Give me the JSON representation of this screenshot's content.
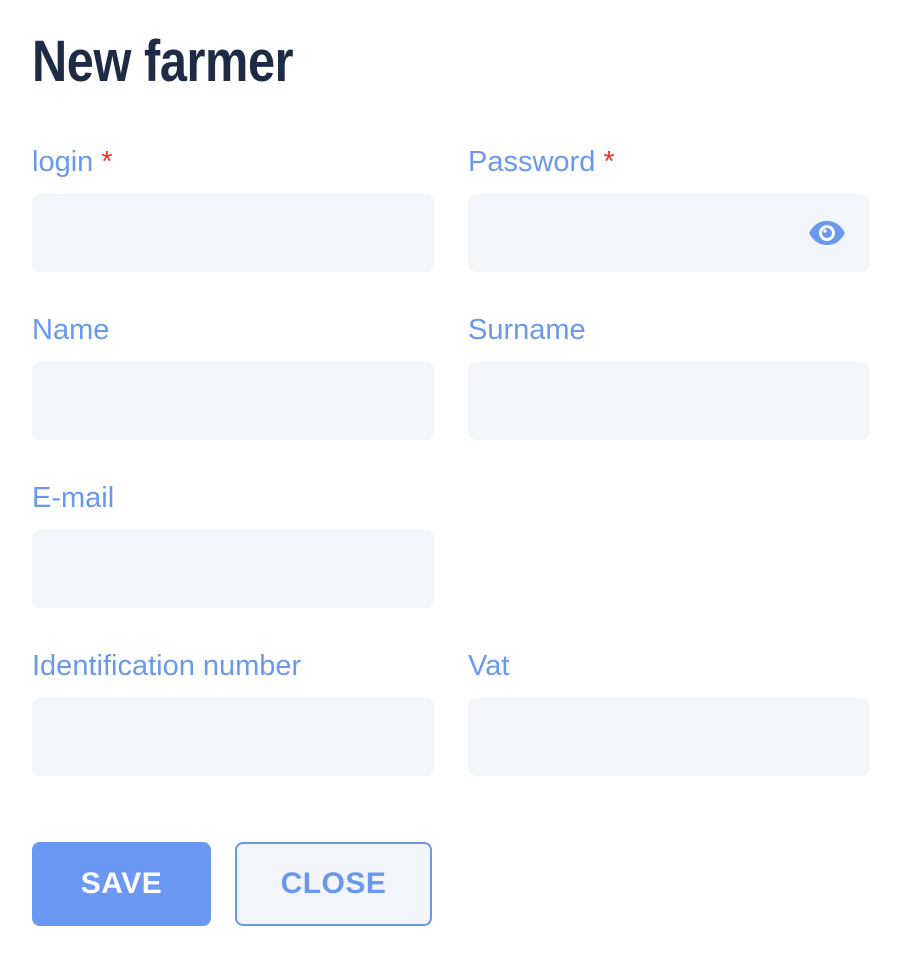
{
  "form": {
    "title": "New farmer",
    "fields": {
      "login": {
        "label": "login",
        "required_mark": "*",
        "value": ""
      },
      "password": {
        "label": "Password",
        "required_mark": "*",
        "value": ""
      },
      "name": {
        "label": "Name",
        "value": ""
      },
      "surname": {
        "label": "Surname",
        "value": ""
      },
      "email": {
        "label": "E-mail",
        "value": ""
      },
      "identification_number": {
        "label": "Identification number",
        "value": ""
      },
      "vat": {
        "label": "Vat",
        "value": ""
      }
    },
    "actions": {
      "save_label": "SAVE",
      "close_label": "CLOSE"
    }
  },
  "icons": {
    "password_toggle": "eye-icon"
  },
  "colors": {
    "title": "#1f2a44",
    "label": "#6a98ec",
    "required": "#e4352b",
    "input_background": "#f2f5fa",
    "primary_button": "#6a98f2"
  }
}
